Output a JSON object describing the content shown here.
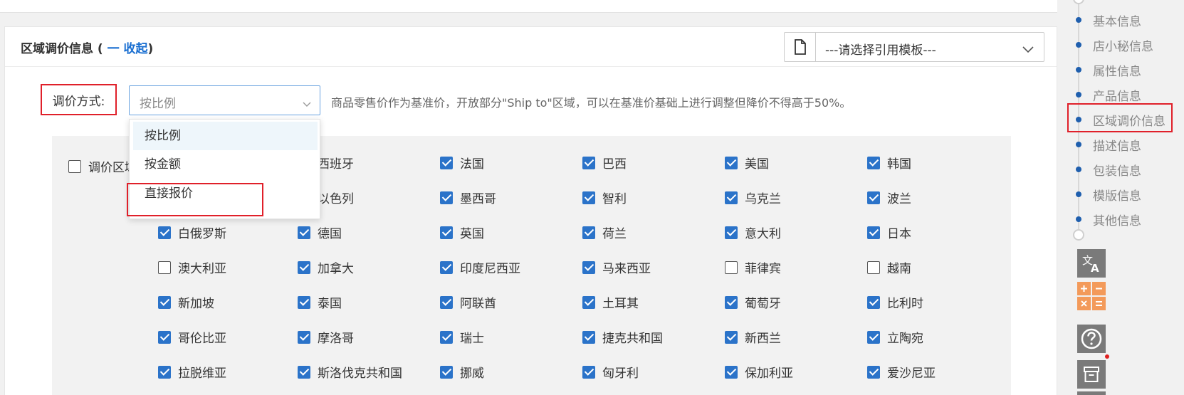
{
  "section": {
    "title": "区域调价信息",
    "title_open_paren": "(",
    "title_close_paren": ")",
    "collapse_label": "一 收起"
  },
  "template_select": {
    "value": "---请选择引用模板---",
    "icon": "document-icon"
  },
  "method": {
    "label": "调价方式:",
    "selected_value": "按比例",
    "description": "商品零售价作为基准价，开放部分\"Ship to\"区域，可以在基准价基础上进行调整但降价不得高于50%。",
    "options": [
      "按比例",
      "按金额",
      "直接报价"
    ],
    "highlighted_option": "按比例",
    "annotated_option": "直接报价"
  },
  "regions": {
    "header_label": "调价区域",
    "header_checked": false,
    "countries": [
      {
        "name": "西班牙",
        "checked": true
      },
      {
        "name": "法国",
        "checked": true
      },
      {
        "name": "巴西",
        "checked": true
      },
      {
        "name": "美国",
        "checked": true
      },
      {
        "name": "韩国",
        "checked": true
      },
      {
        "name": "以色列",
        "checked": true
      },
      {
        "name": "墨西哥",
        "checked": true
      },
      {
        "name": "智利",
        "checked": true
      },
      {
        "name": "乌克兰",
        "checked": true
      },
      {
        "name": "波兰",
        "checked": true
      },
      {
        "name": "白俄罗斯",
        "checked": true
      },
      {
        "name": "德国",
        "checked": true
      },
      {
        "name": "英国",
        "checked": true
      },
      {
        "name": "荷兰",
        "checked": true
      },
      {
        "name": "意大利",
        "checked": true
      },
      {
        "name": "日本",
        "checked": true
      },
      {
        "name": "澳大利亚",
        "checked": false
      },
      {
        "name": "加拿大",
        "checked": true
      },
      {
        "name": "印度尼西亚",
        "checked": true
      },
      {
        "name": "马来西亚",
        "checked": true
      },
      {
        "name": "菲律宾",
        "checked": false
      },
      {
        "name": "越南",
        "checked": false
      },
      {
        "name": "新加坡",
        "checked": true
      },
      {
        "name": "泰国",
        "checked": true
      },
      {
        "name": "阿联酋",
        "checked": true
      },
      {
        "name": "土耳其",
        "checked": true
      },
      {
        "name": "葡萄牙",
        "checked": true
      },
      {
        "name": "比利时",
        "checked": true
      },
      {
        "name": "哥伦比亚",
        "checked": true
      },
      {
        "name": "摩洛哥",
        "checked": true
      },
      {
        "name": "瑞士",
        "checked": true
      },
      {
        "name": "捷克共和国",
        "checked": true
      },
      {
        "name": "新西兰",
        "checked": true
      },
      {
        "name": "立陶宛",
        "checked": true
      },
      {
        "name": "拉脱维亚",
        "checked": true
      },
      {
        "name": "斯洛伐克共和国",
        "checked": true
      },
      {
        "name": "挪威",
        "checked": true
      },
      {
        "name": "匈牙利",
        "checked": true
      },
      {
        "name": "保加利亚",
        "checked": true
      },
      {
        "name": "爱沙尼亚",
        "checked": true
      }
    ]
  },
  "right_nav": {
    "items": [
      "基本信息",
      "店小秘信息",
      "属性信息",
      "产品信息",
      "区域调价信息",
      "描述信息",
      "包装信息",
      "模版信息",
      "其他信息"
    ],
    "active": "区域调价信息"
  },
  "tools": [
    "translate-icon",
    "calculator-icon",
    "help-icon",
    "archive-icon"
  ],
  "colors": {
    "accent_blue": "#2b73c9",
    "annotation_red": "#e0202a",
    "calculator_orange": "#f39a5a",
    "notification_dot": "#e02020"
  }
}
